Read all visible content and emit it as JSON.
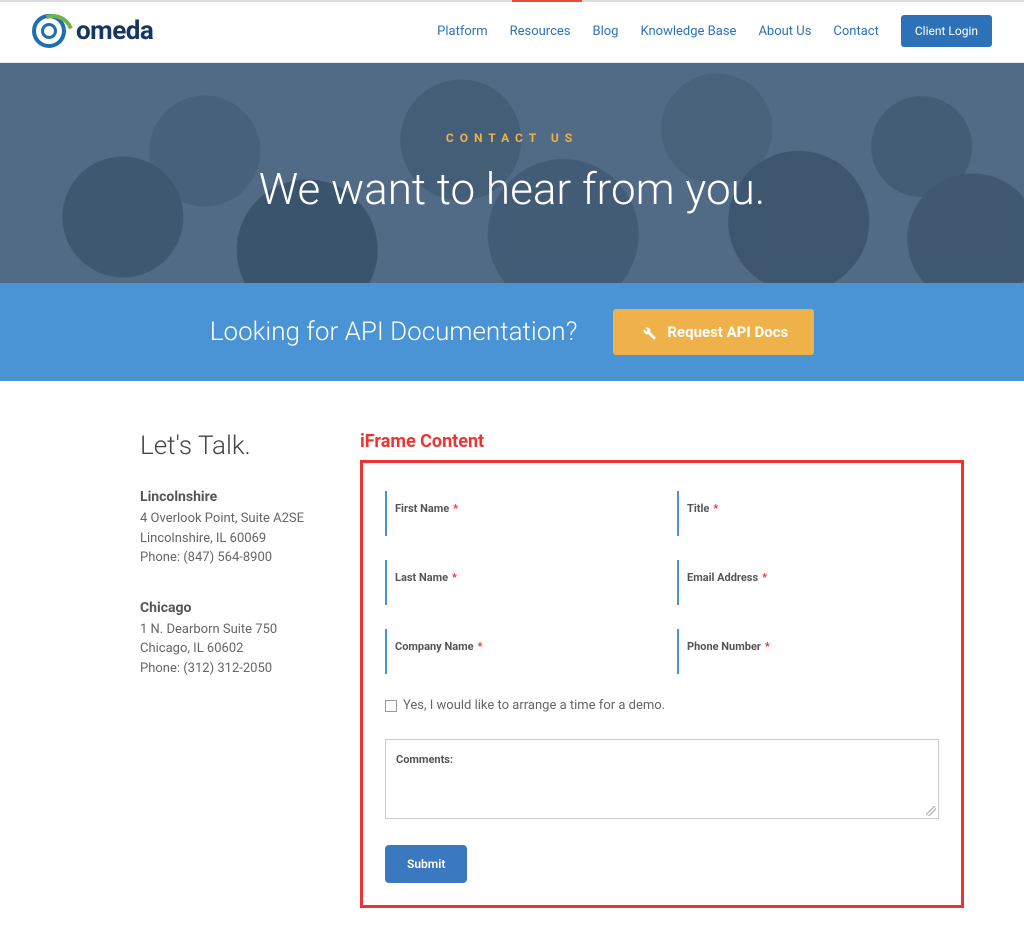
{
  "brand": "omeda",
  "nav": {
    "items": [
      "Platform",
      "Resources",
      "Blog",
      "Knowledge Base",
      "About Us",
      "Contact"
    ],
    "login": "Client Login"
  },
  "hero": {
    "eyebrow": "CONTACT US",
    "title": "We want to hear from you."
  },
  "api_banner": {
    "text": "Looking for API Documentation?",
    "cta": "Request API Docs"
  },
  "sidebar": {
    "heading": "Let's Talk.",
    "offices": [
      {
        "name": "Lincolnshire",
        "line1": "4 Overlook Point, Suite A2SE",
        "line2": "Lincolnshire, IL 60069",
        "phone": "Phone: (847) 564-8900"
      },
      {
        "name": "Chicago",
        "line1": "1 N. Dearborn Suite 750",
        "line2": "Chicago, IL 60602",
        "phone": "Phone: (312) 312-2050"
      }
    ]
  },
  "iframe": {
    "label": "iFrame Content",
    "fields": {
      "first_name": "First Name",
      "title_field": "Title",
      "last_name": "Last Name",
      "email": "Email Address",
      "company": "Company Name",
      "phone": "Phone Number"
    },
    "required_mark": "*",
    "checkbox_label": "Yes, I would like to arrange a time for a demo.",
    "comments_label": "Comments:",
    "submit": "Submit"
  }
}
